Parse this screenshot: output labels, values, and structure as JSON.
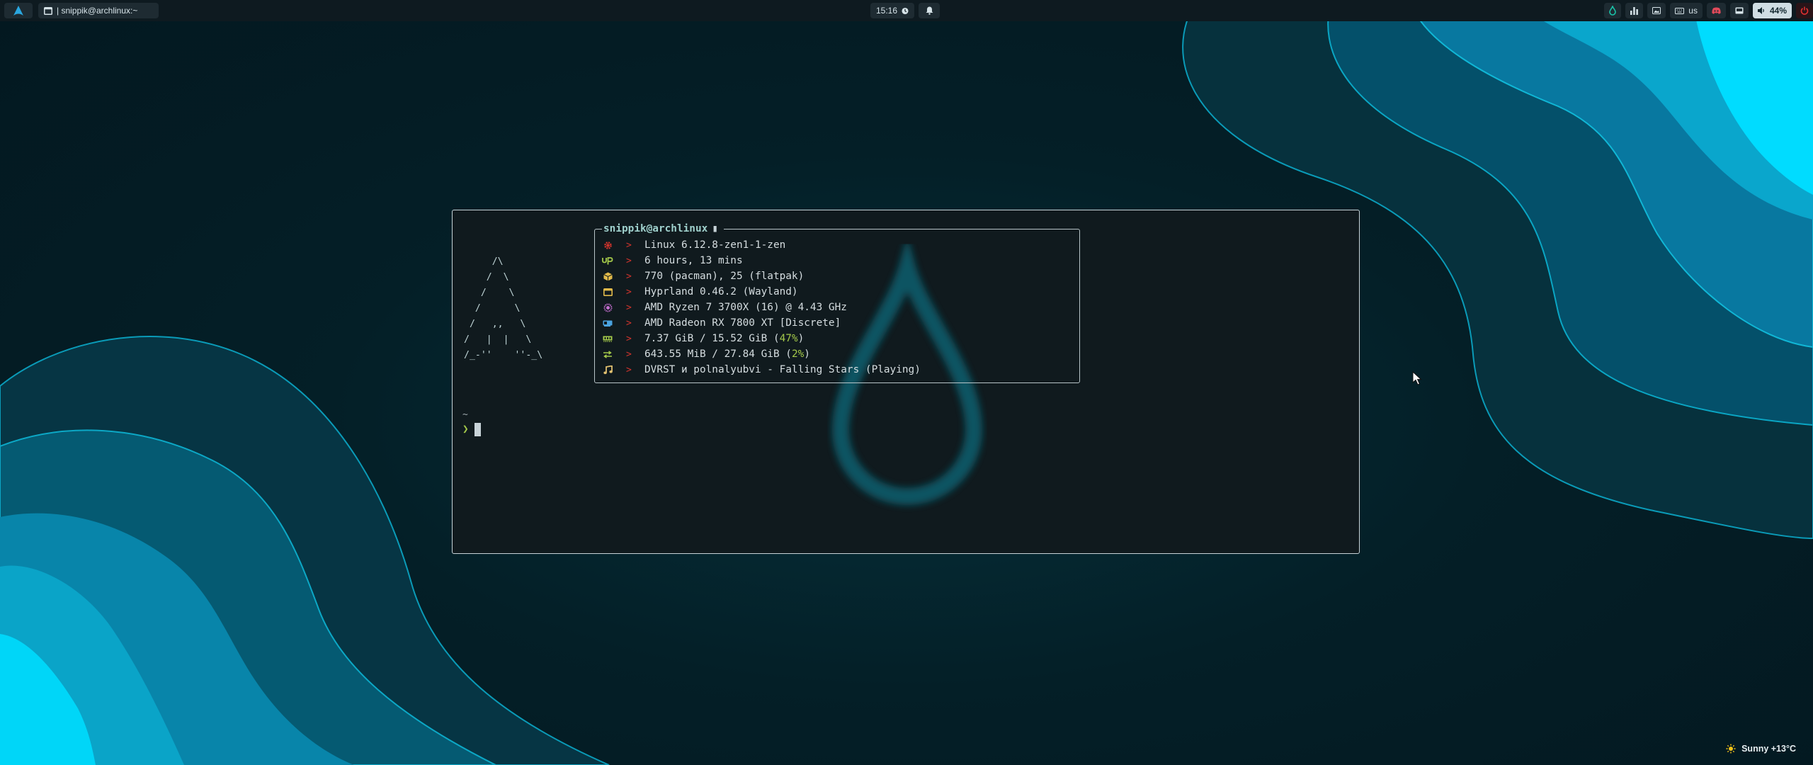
{
  "colors": {
    "accent": "#00e1ff",
    "bar_bg": "#0e1a20",
    "terminal_bg": "#101a1e",
    "arrow": "#d0342c",
    "percent": "#a4c94a"
  },
  "topbar": {
    "launcher_icon": "arch-logo-icon",
    "window_icon": "window-icon",
    "window_title": "| snippik@archlinux:~",
    "clock": "15:16",
    "clock_icon": "clock-icon",
    "notification_icon": "bell-icon",
    "tray": {
      "keyboard_layout": "us",
      "volume": "44%",
      "icons": [
        "droplet-icon",
        "equalizer-icon",
        "picture-icon",
        "keyboard-icon",
        "discord-icon",
        "screen-icon",
        "speaker-icon",
        "power-icon"
      ]
    }
  },
  "terminal": {
    "ascii_art": "     /\\\n    /  \\\n   /    \\\n  /      \\\n /   ,,   \\\n/   |  |   \\\n/_-''    ''-_\\",
    "fastfetch": {
      "title": "snippik@archlinux",
      "title_icon": "battery-icon",
      "rows": [
        {
          "icon": "gear-icon",
          "color": "#d0342c",
          "value": "Linux 6.12.8-zen1-1-zen"
        },
        {
          "icon": "uptime-icon",
          "color": "#a4c94a",
          "value": "6 hours, 13 mins"
        },
        {
          "icon": "package-icon",
          "color": "#e0b94a",
          "value": "770 (pacman), 25 (flatpak)"
        },
        {
          "icon": "window-icon",
          "color": "#e0b94a",
          "value": "Hyprland 0.46.2 (Wayland)"
        },
        {
          "icon": "cpu-icon",
          "color": "#c56fd0",
          "value": "AMD Ryzen 7 3700X (16) @ 4.43 GHz"
        },
        {
          "icon": "gpu-icon",
          "color": "#4aa3e0",
          "value": "AMD Radeon RX 7800 XT [Discrete]"
        },
        {
          "icon": "memory-icon",
          "color": "#a4c94a",
          "value": "7.37 GiB / 15.52 GiB (",
          "percent": "47%",
          "suffix": ")"
        },
        {
          "icon": "swap-icon",
          "color": "#a4c94a",
          "value": "643.55 MiB / 27.84 GiB (",
          "percent": "2%",
          "suffix": ")"
        },
        {
          "icon": "music-icon",
          "color": "#e0c070",
          "value": "DVRST и polnalyubvi - Falling Stars (Playing)"
        }
      ],
      "arrow": ">"
    },
    "prompt": {
      "cwd": "~",
      "symbol": "❯"
    }
  },
  "weather": {
    "icon": "sun-icon",
    "text": "Sunny +13°C"
  }
}
